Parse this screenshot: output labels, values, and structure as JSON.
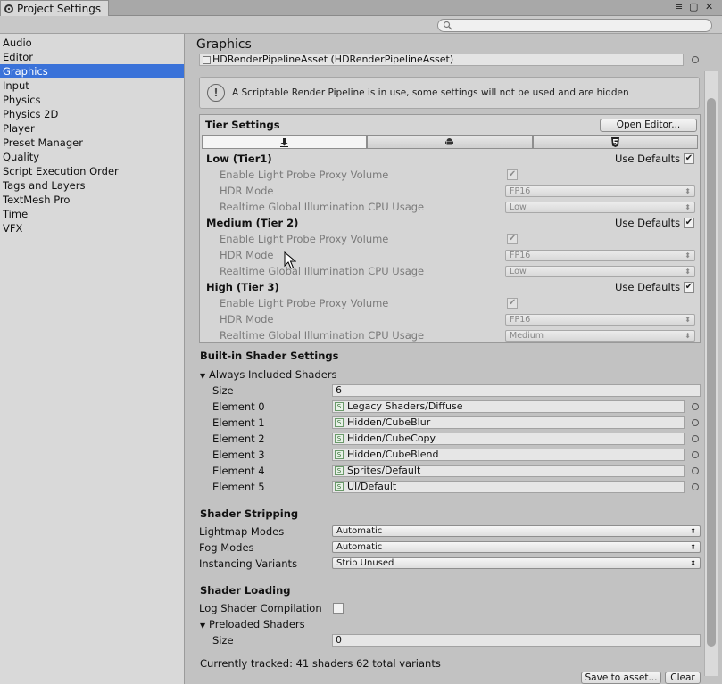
{
  "window": {
    "title": "Project Settings",
    "controls": [
      "≡",
      "▢",
      "✕"
    ]
  },
  "sidebar": {
    "items": [
      {
        "label": "Audio"
      },
      {
        "label": "Editor"
      },
      {
        "label": "Graphics",
        "selected": true
      },
      {
        "label": "Input"
      },
      {
        "label": "Physics"
      },
      {
        "label": "Physics 2D"
      },
      {
        "label": "Player"
      },
      {
        "label": "Preset Manager"
      },
      {
        "label": "Quality"
      },
      {
        "label": "Script Execution Order"
      },
      {
        "label": "Tags and Layers"
      },
      {
        "label": "TextMesh Pro"
      },
      {
        "label": "Time"
      },
      {
        "label": "VFX"
      }
    ]
  },
  "main": {
    "title": "Graphics",
    "asset": "HDRenderPipelineAsset (HDRenderPipelineAsset)",
    "help": "A Scriptable Render Pipeline is in use, some settings will not be used and are hidden",
    "tier": {
      "header": "Tier Settings",
      "open_editor": "Open Editor...",
      "tabs": [
        "standalone-icon",
        "android-icon",
        "html5-icon"
      ],
      "use_defaults_label": "Use Defaults",
      "row_labels": {
        "light_probe": "Enable Light Probe Proxy Volume",
        "hdr_mode": "HDR Mode",
        "gi_cpu": "Realtime Global Illumination CPU Usage"
      },
      "tiers": [
        {
          "name": "Low (Tier1)",
          "hdr": "FP16",
          "gi": "Low"
        },
        {
          "name": "Medium (Tier 2)",
          "hdr": "FP16",
          "gi": "Low"
        },
        {
          "name": "High (Tier 3)",
          "hdr": "FP16",
          "gi": "Medium"
        }
      ]
    },
    "builtin": {
      "header": "Built-in Shader Settings",
      "always_included": "Always Included Shaders",
      "size_label": "Size",
      "size_value": "6",
      "elements": [
        {
          "label": "Element 0",
          "value": "Legacy Shaders/Diffuse"
        },
        {
          "label": "Element 1",
          "value": "Hidden/CubeBlur"
        },
        {
          "label": "Element 2",
          "value": "Hidden/CubeCopy"
        },
        {
          "label": "Element 3",
          "value": "Hidden/CubeBlend"
        },
        {
          "label": "Element 4",
          "value": "Sprites/Default"
        },
        {
          "label": "Element 5",
          "value": "UI/Default"
        }
      ]
    },
    "stripping": {
      "header": "Shader Stripping",
      "lightmap_label": "Lightmap Modes",
      "lightmap_value": "Automatic",
      "fog_label": "Fog Modes",
      "fog_value": "Automatic",
      "instancing_label": "Instancing Variants",
      "instancing_value": "Strip Unused"
    },
    "loading": {
      "header": "Shader Loading",
      "log_label": "Log Shader Compilation",
      "preloaded": "Preloaded Shaders",
      "size_label": "Size",
      "size_value": "0"
    },
    "tracked": "Currently tracked: 41 shaders 62 total variants",
    "save_btn": "Save to asset...",
    "clear_btn": "Clear"
  }
}
